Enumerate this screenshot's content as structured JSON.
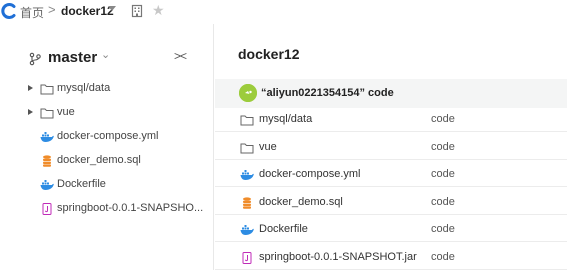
{
  "breadcrumb": {
    "home": "首页",
    "separator": ">",
    "repo": "docker12"
  },
  "sidebar": {
    "branch": "master",
    "collapse_label": "><",
    "items": [
      {
        "label": "mysql/data",
        "kind": "folder",
        "expandable": true
      },
      {
        "label": "vue",
        "kind": "folder",
        "expandable": true
      },
      {
        "label": "docker-compose.yml",
        "kind": "docker"
      },
      {
        "label": "docker_demo.sql",
        "kind": "sql"
      },
      {
        "label": "Dockerfile",
        "kind": "docker"
      },
      {
        "label": "springboot-0.0.1-SNAPSHO...",
        "kind": "jar"
      }
    ]
  },
  "main": {
    "title": "docker12",
    "commit": {
      "text": "“aliyun0221354154” code"
    },
    "files": [
      {
        "name": "mysql/data",
        "kind": "folder",
        "message": "code"
      },
      {
        "name": "vue",
        "kind": "folder",
        "message": "code"
      },
      {
        "name": "docker-compose.yml",
        "kind": "docker",
        "message": "code"
      },
      {
        "name": "docker_demo.sql",
        "kind": "sql",
        "message": "code"
      },
      {
        "name": "Dockerfile",
        "kind": "docker",
        "message": "code"
      },
      {
        "name": "springboot-0.0.1-SNAPSHOT.jar",
        "kind": "jar",
        "message": "code"
      }
    ]
  },
  "colors": {
    "logo": "#1f6fd6",
    "docker": "#2d8ce3",
    "sql": "#f08c2a",
    "jar": "#c02bb8",
    "avatar": "#9ccc3c",
    "commit_bg": "#f4f5f5"
  }
}
